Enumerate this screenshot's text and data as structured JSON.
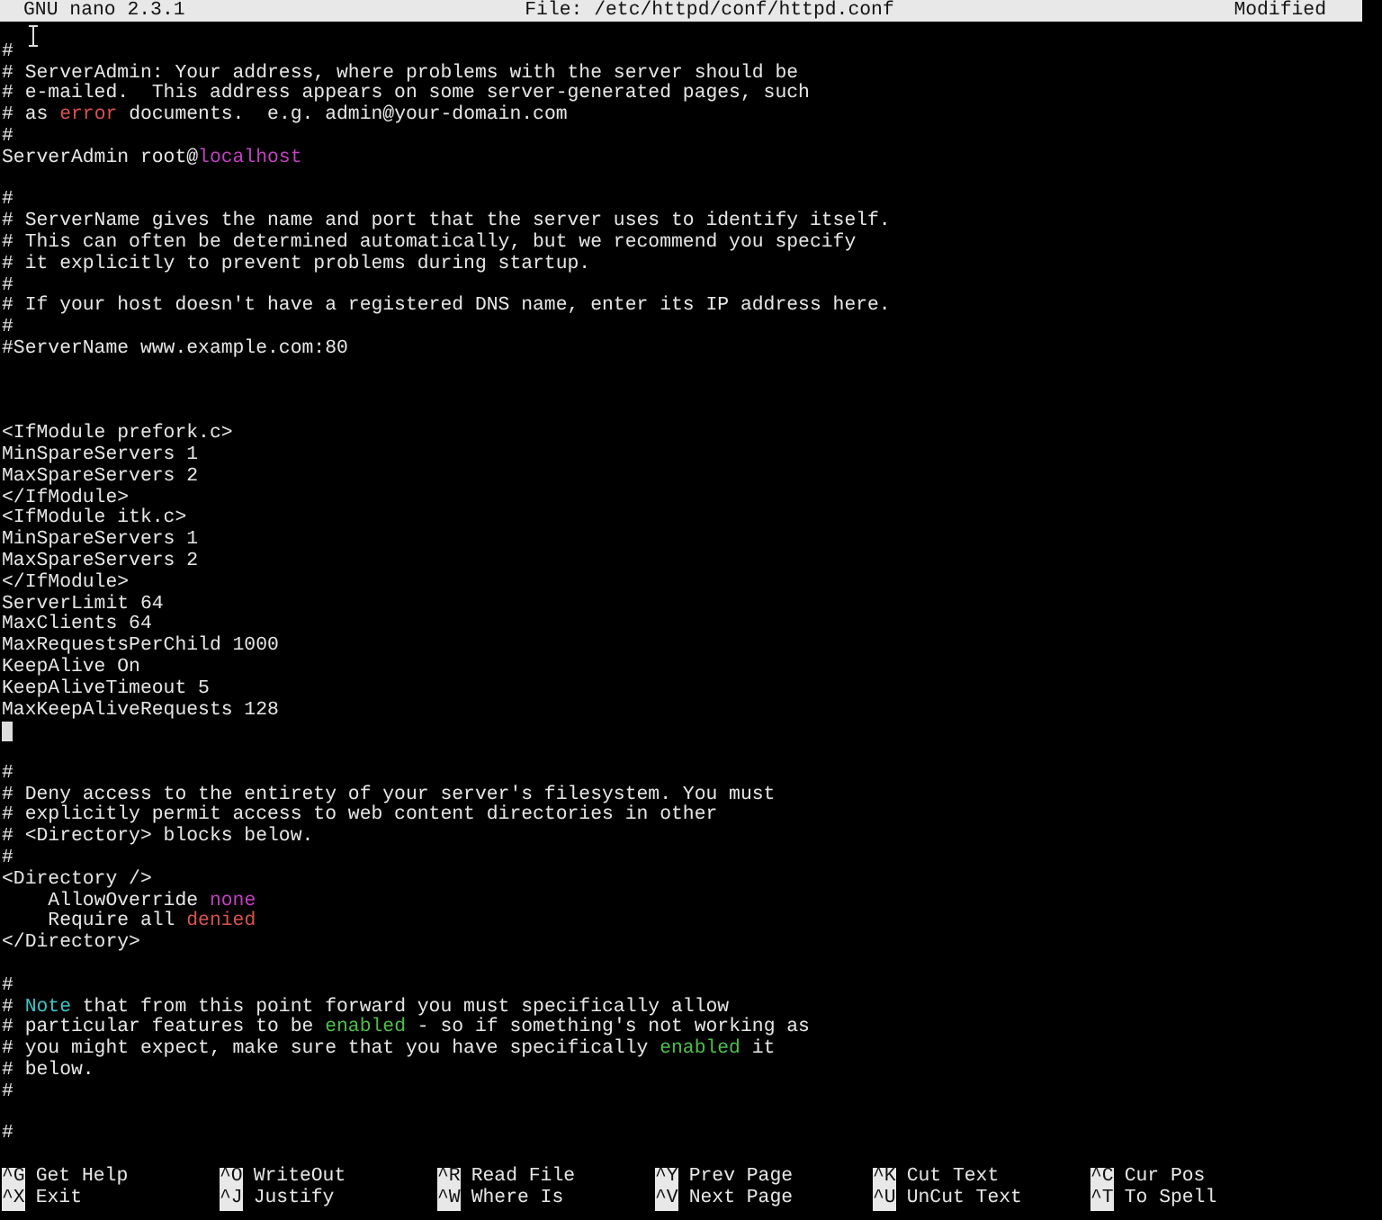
{
  "title_bar": {
    "program": "GNU nano 2.3.1",
    "file": "File: /etc/httpd/conf/httpd.conf",
    "state": "Modified"
  },
  "lines": [
    {
      "kind": "blank"
    },
    {
      "segments": [
        {
          "text": "#"
        }
      ]
    },
    {
      "segments": [
        {
          "text": "# ServerAdmin: Your address, where problems with the server should be"
        }
      ]
    },
    {
      "segments": [
        {
          "text": "# e-mailed.  This address appears on some server-generated pages, such"
        }
      ]
    },
    {
      "segments": [
        {
          "text": "# as "
        },
        {
          "text": "error",
          "color": "#d9534f"
        },
        {
          "text": " documents.  e.g. admin@your-domain.com"
        }
      ]
    },
    {
      "segments": [
        {
          "text": "#"
        }
      ]
    },
    {
      "segments": [
        {
          "text": "ServerAdmin root@"
        },
        {
          "text": "localhost",
          "color": "#c040c0"
        }
      ]
    },
    {
      "kind": "blank"
    },
    {
      "segments": [
        {
          "text": "#"
        }
      ]
    },
    {
      "segments": [
        {
          "text": "# ServerName gives the name and port that the server uses to identify itself."
        }
      ]
    },
    {
      "segments": [
        {
          "text": "# This can often be determined automatically, but we recommend you specify"
        }
      ]
    },
    {
      "segments": [
        {
          "text": "# it explicitly to prevent problems during startup."
        }
      ]
    },
    {
      "segments": [
        {
          "text": "#"
        }
      ]
    },
    {
      "segments": [
        {
          "text": "# If your host doesn't have a registered DNS name, enter its IP address here."
        }
      ]
    },
    {
      "segments": [
        {
          "text": "#"
        }
      ]
    },
    {
      "segments": [
        {
          "text": "#ServerName www.example.com:80"
        }
      ]
    },
    {
      "kind": "blank"
    },
    {
      "kind": "blank"
    },
    {
      "kind": "blank"
    },
    {
      "segments": [
        {
          "text": "<IfModule prefork.c>"
        }
      ]
    },
    {
      "segments": [
        {
          "text": "MinSpareServers 1"
        }
      ]
    },
    {
      "segments": [
        {
          "text": "MaxSpareServers 2"
        }
      ]
    },
    {
      "segments": [
        {
          "text": "</IfModule>"
        }
      ]
    },
    {
      "segments": [
        {
          "text": "<IfModule itk.c>"
        }
      ]
    },
    {
      "segments": [
        {
          "text": "MinSpareServers 1"
        }
      ]
    },
    {
      "segments": [
        {
          "text": "MaxSpareServers 2"
        }
      ]
    },
    {
      "segments": [
        {
          "text": "</IfModule>"
        }
      ]
    },
    {
      "segments": [
        {
          "text": "ServerLimit 64"
        }
      ]
    },
    {
      "segments": [
        {
          "text": "MaxClients 64"
        }
      ]
    },
    {
      "segments": [
        {
          "text": "MaxRequestsPerChild 1000"
        }
      ]
    },
    {
      "segments": [
        {
          "text": "KeepAlive On"
        }
      ]
    },
    {
      "segments": [
        {
          "text": "KeepAliveTimeout 5"
        }
      ]
    },
    {
      "segments": [
        {
          "text": "MaxKeepAliveRequests 128"
        }
      ]
    },
    {
      "kind": "cursor"
    },
    {
      "kind": "blank"
    },
    {
      "segments": [
        {
          "text": "#"
        }
      ]
    },
    {
      "segments": [
        {
          "text": "# Deny access to the entirety of your server's filesystem. You must"
        }
      ]
    },
    {
      "segments": [
        {
          "text": "# explicitly permit access to web content directories in other"
        }
      ]
    },
    {
      "segments": [
        {
          "text": "# <Directory> blocks below."
        }
      ]
    },
    {
      "segments": [
        {
          "text": "#"
        }
      ]
    },
    {
      "segments": [
        {
          "text": "<Directory />"
        }
      ]
    },
    {
      "segments": [
        {
          "text": "    AllowOverride "
        },
        {
          "text": "none",
          "color": "#c040c0"
        }
      ]
    },
    {
      "segments": [
        {
          "text": "    Require all "
        },
        {
          "text": "denied",
          "color": "#d9534f"
        }
      ]
    },
    {
      "segments": [
        {
          "text": "</Directory>"
        }
      ]
    },
    {
      "kind": "blank"
    },
    {
      "segments": [
        {
          "text": "#"
        }
      ]
    },
    {
      "segments": [
        {
          "text": "# "
        },
        {
          "text": "Note",
          "color": "#3fc4c4"
        },
        {
          "text": " that from this point forward you must specifically allow"
        }
      ]
    },
    {
      "segments": [
        {
          "text": "# particular features to be "
        },
        {
          "text": "enabled",
          "color": "#4cbf4c"
        },
        {
          "text": " - so if something's not working as"
        }
      ]
    },
    {
      "segments": [
        {
          "text": "# you might expect, make sure that you have specifically "
        },
        {
          "text": "enabled",
          "color": "#4cbf4c"
        },
        {
          "text": " it"
        }
      ]
    },
    {
      "segments": [
        {
          "text": "# below."
        }
      ]
    },
    {
      "segments": [
        {
          "text": "#"
        }
      ]
    },
    {
      "kind": "blank"
    },
    {
      "segments": [
        {
          "text": "#"
        }
      ]
    }
  ],
  "shortcuts": [
    {
      "key": "^G",
      "label": "Get Help"
    },
    {
      "key": "^O",
      "label": "WriteOut"
    },
    {
      "key": "^R",
      "label": "Read File"
    },
    {
      "key": "^Y",
      "label": "Prev Page"
    },
    {
      "key": "^K",
      "label": "Cut Text"
    },
    {
      "key": "^C",
      "label": "Cur Pos"
    },
    {
      "key": "^X",
      "label": "Exit"
    },
    {
      "key": "^J",
      "label": "Justify"
    },
    {
      "key": "^W",
      "label": "Where Is"
    },
    {
      "key": "^V",
      "label": "Next Page"
    },
    {
      "key": "^U",
      "label": "UnCut Text"
    },
    {
      "key": "^T",
      "label": "To Spell"
    }
  ]
}
